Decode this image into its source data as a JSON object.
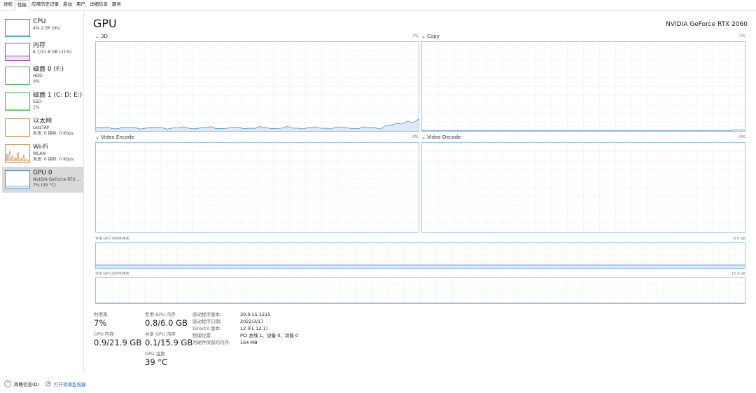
{
  "tabs": [
    "进程",
    "性能",
    "应用历史记录",
    "启动",
    "用户",
    "详细信息",
    "服务"
  ],
  "sidebar": {
    "items": [
      {
        "title": "CPU",
        "sub1": "4% 2.36 GHz",
        "sub2": "",
        "color": "#1e90d6"
      },
      {
        "title": "内存",
        "sub1": "6.7/31.8 GB (21%)",
        "sub2": "",
        "color": "#a64bbf"
      },
      {
        "title": "磁盘 0 (F:)",
        "sub1": "HDD",
        "sub2": "0%",
        "color": "#4caf50"
      },
      {
        "title": "磁盘 1 (C: D: E:)",
        "sub1": "SSD",
        "sub2": "1%",
        "color": "#4caf50"
      },
      {
        "title": "以太网",
        "sub1": "LetsTAP",
        "sub2": "发送: 0 接收: 0 Kbps",
        "color": "#c98a52"
      },
      {
        "title": "Wi-Fi",
        "sub1": "WLAN",
        "sub2": "发送: 0 接收: 0 Kbps",
        "color": "#c98a52"
      },
      {
        "title": "GPU 0",
        "sub1": "NVIDIA GeForce RTX ...",
        "sub2": "7% (39 °C)",
        "color": "#4a8fd6"
      }
    ]
  },
  "main": {
    "title": "GPU",
    "gpu_name": "NVIDIA GeForce RTX 2060",
    "graphs": [
      {
        "label": "3D",
        "pct": "7%"
      },
      {
        "label": "Copy",
        "pct": "1%"
      },
      {
        "label": "Video Encode",
        "pct": "0%"
      },
      {
        "label": "Video Decode",
        "pct": "0%"
      }
    ],
    "dedicated_mem": {
      "label": "专用 GPU 内存利用率",
      "max": "6.0 GB"
    },
    "shared_mem": {
      "label": "共享 GPU 内存利用率",
      "max": "15.9 GB"
    }
  },
  "stats": {
    "utilization": {
      "label": "利用率",
      "value": "7%"
    },
    "gpu_memory": {
      "label": "GPU 内存",
      "value": "0.9/21.9 GB"
    },
    "dedicated": {
      "label": "专用 GPU 内存",
      "value": "0.8/6.0 GB"
    },
    "shared": {
      "label": "共享 GPU 内存",
      "value": "0.1/15.9 GB"
    },
    "temperature": {
      "label": "GPU 温度",
      "value": "39 °C"
    }
  },
  "info": [
    {
      "key": "驱动程序版本:",
      "value": "30.0.15.1215"
    },
    {
      "key": "驱动程序日期:",
      "value": "2022/3/17"
    },
    {
      "key": "DirectX 版本:",
      "value": "12 (FL 12.1)"
    },
    {
      "key": "物理位置:",
      "value": "PCI 总线 1、设备 0、功能 0"
    },
    {
      "key": "为硬件保留的内存:",
      "value": "164 MB"
    }
  ],
  "footer": {
    "brief": "简略信息(D)",
    "open_monitor": "打开资源监视器"
  }
}
